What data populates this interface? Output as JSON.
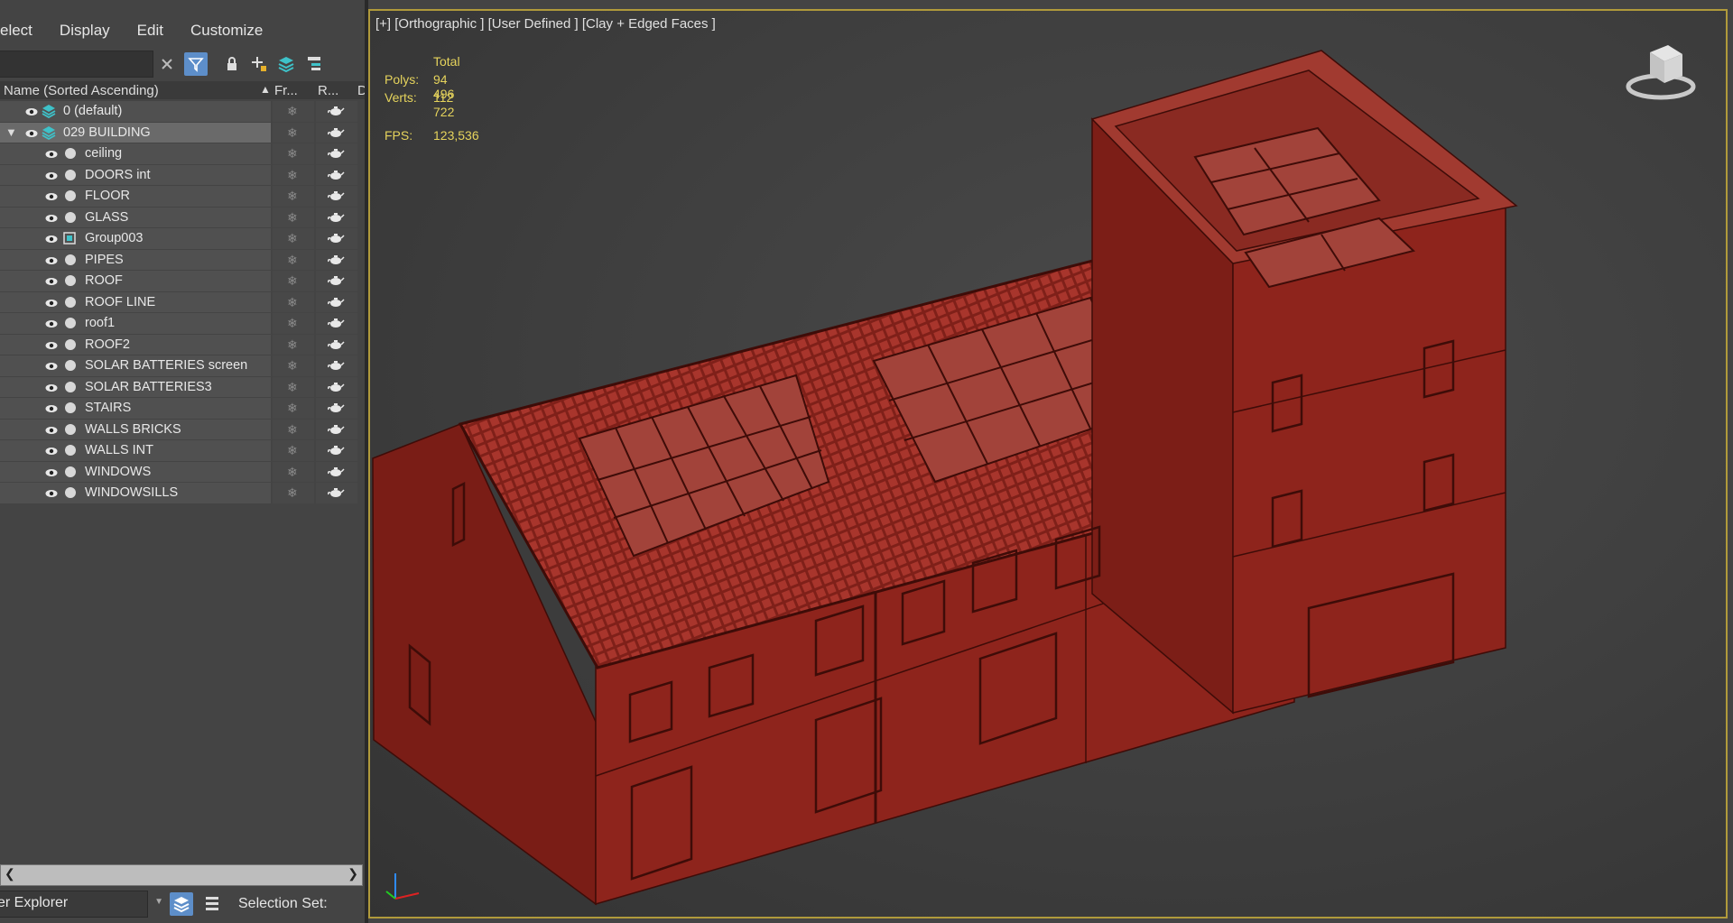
{
  "menu": {
    "items": [
      "elect",
      "Display",
      "Edit",
      "Customize"
    ]
  },
  "explorer": {
    "columns": {
      "name": "Name (Sorted Ascending)",
      "frozen": "Fr...",
      "render": "R...",
      "extra": "D"
    },
    "layers": [
      {
        "name": "0 (default)",
        "indent": 0,
        "type": "layer"
      },
      {
        "name": "029 BUILDING",
        "indent": 0,
        "type": "layer",
        "selected": true,
        "expanded": true
      },
      {
        "name": "ceiling",
        "indent": 1,
        "type": "object"
      },
      {
        "name": "DOORS int",
        "indent": 1,
        "type": "object"
      },
      {
        "name": "FLOOR",
        "indent": 1,
        "type": "object"
      },
      {
        "name": "GLASS",
        "indent": 1,
        "type": "object"
      },
      {
        "name": "Group003",
        "indent": 1,
        "type": "group"
      },
      {
        "name": "PIPES",
        "indent": 1,
        "type": "object"
      },
      {
        "name": "ROOF",
        "indent": 1,
        "type": "object"
      },
      {
        "name": "ROOF LINE",
        "indent": 1,
        "type": "object"
      },
      {
        "name": "roof1",
        "indent": 1,
        "type": "object"
      },
      {
        "name": "ROOF2",
        "indent": 1,
        "type": "object"
      },
      {
        "name": "SOLAR BATTERIES screen",
        "indent": 1,
        "type": "object"
      },
      {
        "name": "SOLAR BATTERIES3",
        "indent": 1,
        "type": "object"
      },
      {
        "name": "STAIRS",
        "indent": 1,
        "type": "object"
      },
      {
        "name": "WALLS BRICKS",
        "indent": 1,
        "type": "object"
      },
      {
        "name": "WALLS INT",
        "indent": 1,
        "type": "object"
      },
      {
        "name": "WINDOWS",
        "indent": 1,
        "type": "object"
      },
      {
        "name": "WINDOWSILLS",
        "indent": 1,
        "type": "object"
      }
    ]
  },
  "status": {
    "explorer_name": "er Explorer",
    "selection_set_label": "Selection Set:"
  },
  "viewport": {
    "label": "[+] [Orthographic ] [User Defined ] [Clay + Edged Faces ]",
    "stats": {
      "total_label": "Total",
      "polys_label": "Polys:",
      "polys": "94 496",
      "verts_label": "Verts:",
      "verts": "112 722",
      "fps_label": "FPS:",
      "fps": "123,536"
    },
    "border_color": "#b09a3b",
    "model_color": "#8b231c"
  },
  "icons": {
    "eye": "eye-icon",
    "layer": "layer-stack-icon",
    "freeze": "snowflake-icon",
    "render": "teapot-icon",
    "close": "close-icon",
    "filter": "filter-icon",
    "lock": "lock-icon",
    "add": "add-layer-icon",
    "layers": "layers-icon",
    "hierarchy": "hierarchy-icon",
    "viewcube": "viewcube-icon",
    "axis": "axis-tripod-icon"
  }
}
